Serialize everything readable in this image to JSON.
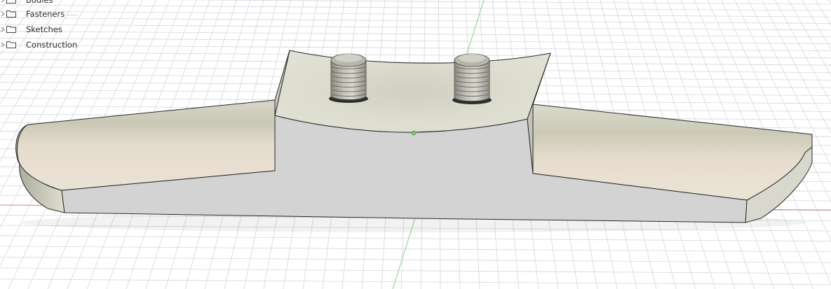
{
  "browser": {
    "items": [
      {
        "label": "Bodies",
        "icon": "folder-icon"
      },
      {
        "label": "Fasteners",
        "icon": "folder-icon"
      },
      {
        "label": "Sketches",
        "icon": "folder-icon"
      },
      {
        "label": "Construction",
        "icon": "folder-icon"
      }
    ]
  },
  "colors": {
    "background": "#ffffff",
    "grid": "#d2d7de",
    "x_axis": "#e07070",
    "y_axis": "#6fd46f",
    "model_face": "#d3d3d3",
    "model_edge": "#2a2a2a"
  }
}
